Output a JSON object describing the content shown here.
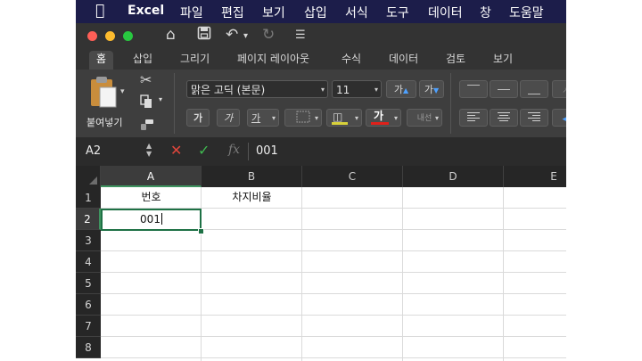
{
  "menubar": {
    "app_name": "Excel",
    "items": [
      "파일",
      "편집",
      "보기",
      "삽입",
      "서식",
      "도구",
      "데이터",
      "창",
      "도움말"
    ]
  },
  "titlebar": {
    "colors": {
      "close": "#fe5f57",
      "minimize": "#febc2e",
      "zoom": "#28c840"
    }
  },
  "ribbon_tabs": [
    "홈",
    "삽입",
    "그리기",
    "페이지 레이아웃",
    "수식",
    "데이터",
    "검토",
    "보기"
  ],
  "ribbon": {
    "paste_label": "붙여넣기",
    "font_name": "맑은 고딕 (본문)",
    "font_size": "11",
    "grow_font": "가",
    "shrink_font": "가",
    "bold": "가",
    "italic": "가",
    "underline": "가",
    "font_color_glyph": "가",
    "phonetic": "내선",
    "font_color_bar": "#e0201a",
    "fill_color_bar": "#d8d13a"
  },
  "formula_bar": {
    "name_box": "A2",
    "cancel": "✕",
    "enter": "✓",
    "fx": "fx",
    "value": "001"
  },
  "columns": [
    "A",
    "B",
    "C",
    "D",
    "E"
  ],
  "rows": [
    "1",
    "2",
    "3",
    "4",
    "5",
    "6",
    "7",
    "8"
  ],
  "cells": {
    "A1": "번호",
    "B1": "차지비율",
    "A2": "001"
  },
  "accent": "#1e7145"
}
